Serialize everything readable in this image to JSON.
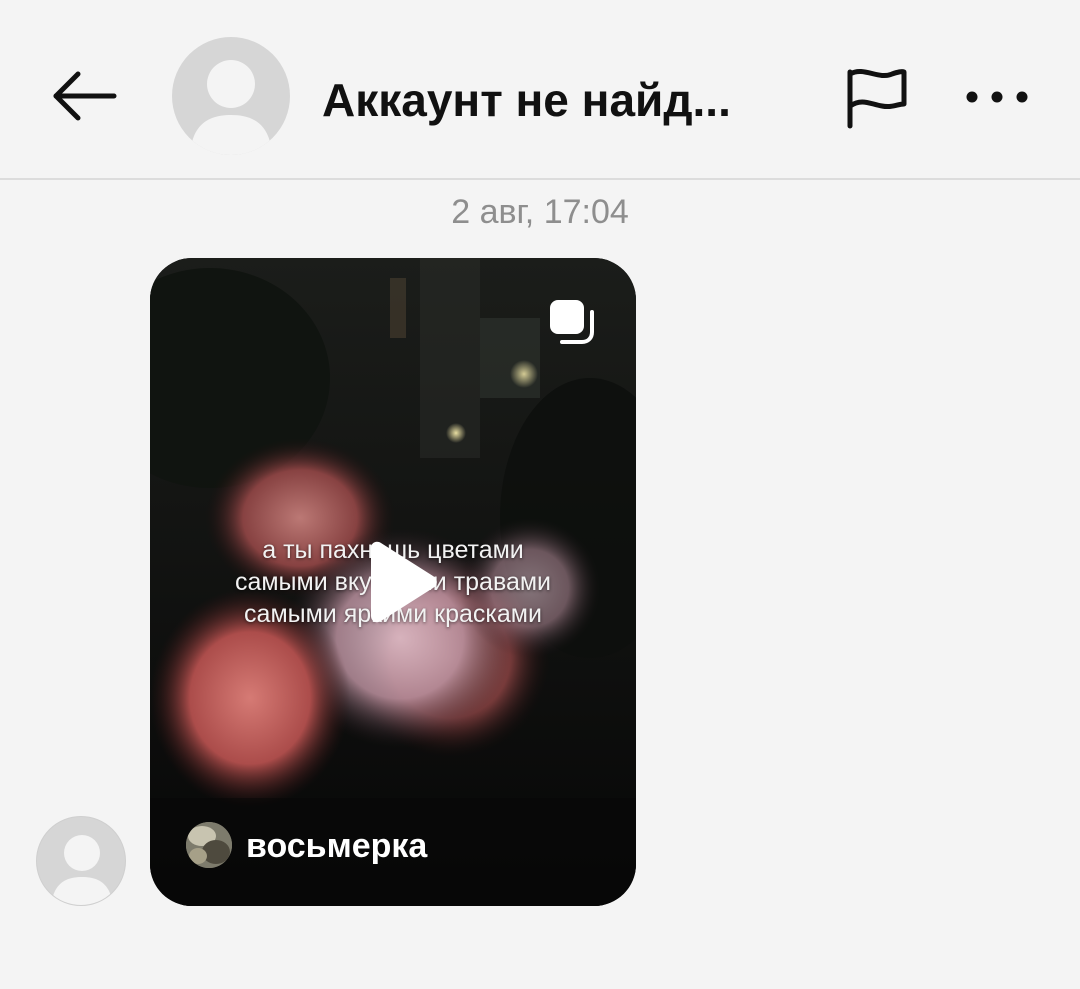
{
  "header": {
    "title": "Аккаунт не найд...",
    "back_icon": "arrow-left-icon",
    "flag_icon": "flag-icon",
    "more_icon": "more-horizontal-icon"
  },
  "thread": {
    "timestamp": "2 авг, 17:04"
  },
  "message": {
    "type": "shared-reel",
    "caption_lines": [
      "а ты пахнешь цветами",
      "самыми вкусными травами",
      "самыми яркими красками"
    ],
    "author": "восьмерка",
    "play_icon": "play-icon",
    "multi_icon": "carousel-icon"
  },
  "colors": {
    "background": "#f4f4f4",
    "title": "#111111",
    "timestamp": "#8e8e8e",
    "avatar_placeholder": "#d6d6d6"
  }
}
